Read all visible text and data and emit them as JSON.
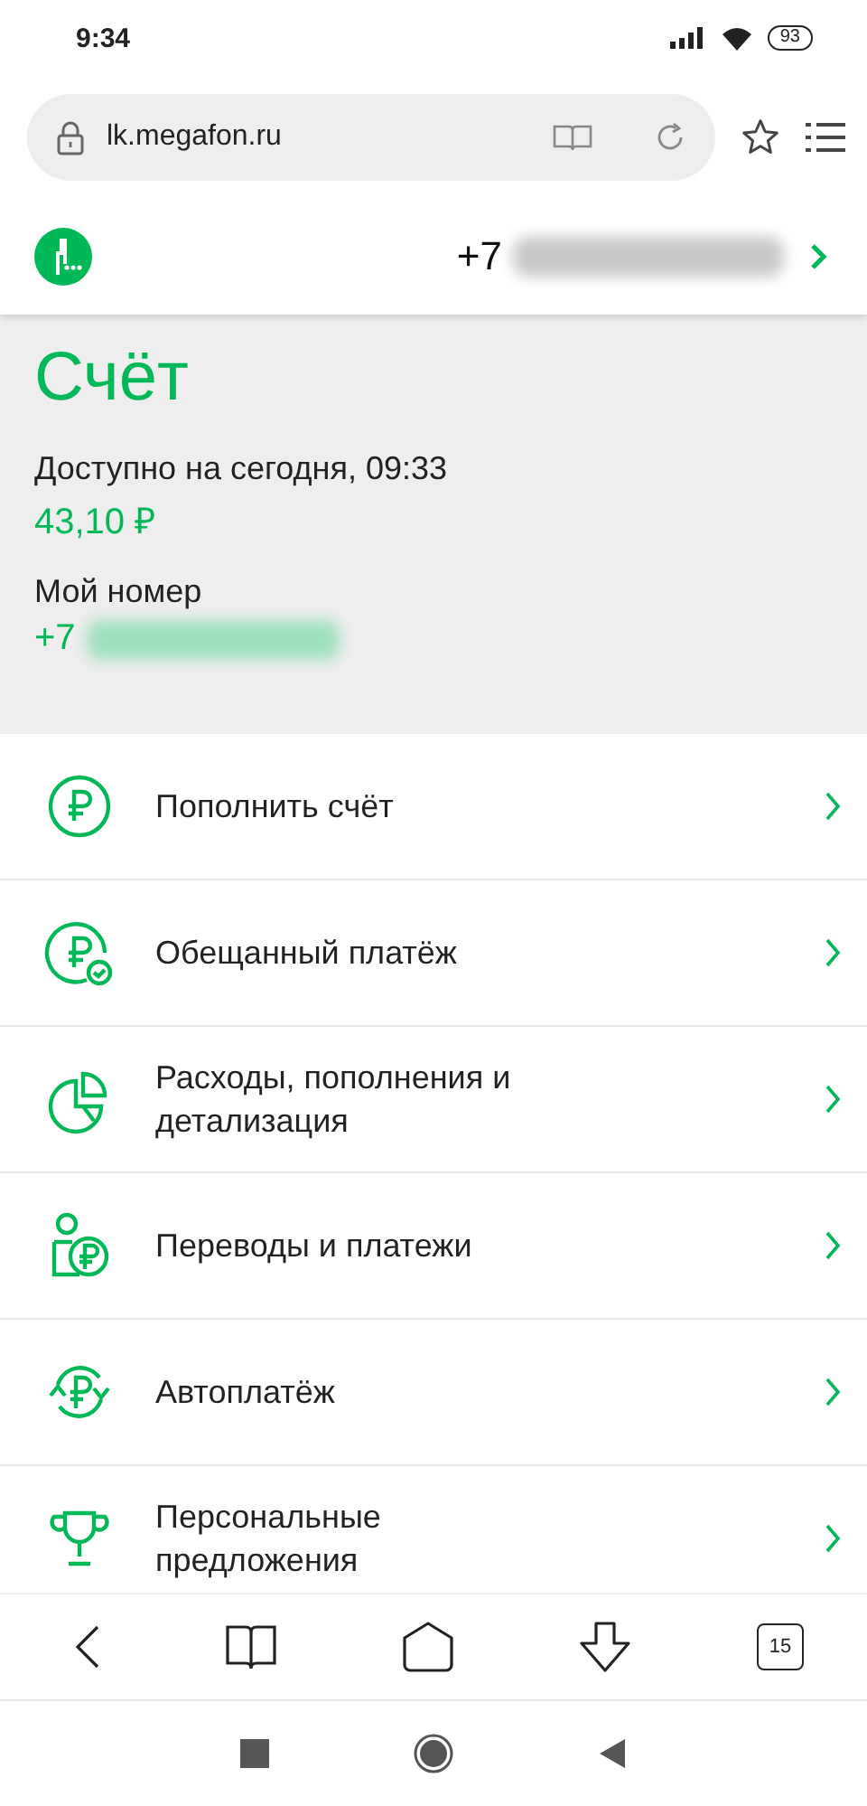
{
  "status_bar": {
    "time": "9:34",
    "battery": "93"
  },
  "address_bar": {
    "url": "lk.megafon.ru"
  },
  "header": {
    "phone_prefix": "+7"
  },
  "account": {
    "title": "Счёт",
    "available_label": "Доступно на сегодня, 09:33",
    "balance": "43,10 ₽",
    "number_label": "Мой номер",
    "number_prefix": "+7"
  },
  "menu": [
    {
      "kind": "topup",
      "label": "Пополнить счёт"
    },
    {
      "kind": "promised",
      "label": "Обещанный платёж"
    },
    {
      "kind": "expenses",
      "label": "Расходы, пополнения и детализация"
    },
    {
      "kind": "transfers",
      "label": "Переводы и платежи"
    },
    {
      "kind": "autopay",
      "label": "Автоплатёж"
    },
    {
      "kind": "offers",
      "label": "Персональные предложения"
    }
  ],
  "toolbar": {
    "tabs_count": "15"
  }
}
